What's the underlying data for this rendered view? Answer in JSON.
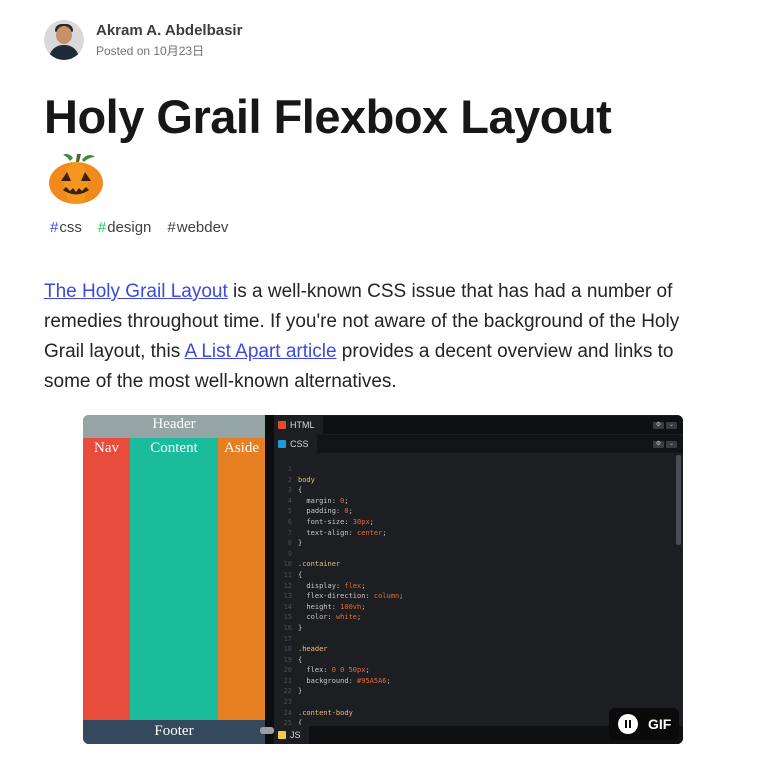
{
  "author": {
    "name": "Akram A. Abdelbasir",
    "posted": "Posted on 10月23日",
    "avatar_icon": "avatar"
  },
  "article": {
    "title": "Holy Grail Flexbox Layout",
    "title_emoji_icon": "jack-o-lantern-icon",
    "tags": [
      {
        "hash": "#",
        "name": "css",
        "hash_color": "#3b49df"
      },
      {
        "hash": "#",
        "name": "design",
        "hash_color": "#22c55e"
      },
      {
        "hash": "#",
        "name": "webdev",
        "hash_color": "#404040"
      }
    ],
    "paragraph": {
      "link1": "The Holy Grail Layout",
      "text1": " is a well-known CSS issue that has had a number of remedies throughout time. If you're not aware of the background of the Holy Grail layout, this ",
      "link2": "A List Apart article",
      "text2": " provides a decent overview and links to some of the most well-known alternatives."
    }
  },
  "gif": {
    "preview": {
      "header": "Header",
      "nav": "Nav",
      "content": "Content",
      "aside": "Aside",
      "footer": "Footer"
    },
    "tabs": {
      "html": "HTML",
      "css": "CSS",
      "js": "JS"
    },
    "code_lines": [
      [
        "1",
        ""
      ],
      [
        "2",
        "body"
      ],
      [
        "3",
        "{"
      ],
      [
        "4",
        "  margin: 0;"
      ],
      [
        "5",
        "  padding: 0;"
      ],
      [
        "6",
        "  font-size: 30px;"
      ],
      [
        "7",
        "  text-align: center;"
      ],
      [
        "8",
        "}"
      ],
      [
        "9",
        ""
      ],
      [
        "10",
        ".container"
      ],
      [
        "11",
        "{"
      ],
      [
        "12",
        "  display: flex;"
      ],
      [
        "13",
        "  flex-direction: column;"
      ],
      [
        "14",
        "  height: 100vh;"
      ],
      [
        "15",
        "  color: white;"
      ],
      [
        "16",
        "}"
      ],
      [
        "17",
        ""
      ],
      [
        "18",
        ".header"
      ],
      [
        "19",
        "{"
      ],
      [
        "20",
        "  flex: 0 0 50px;"
      ],
      [
        "21",
        "  background: #95A5A6;"
      ],
      [
        "22",
        "}"
      ],
      [
        "23",
        ""
      ],
      [
        "24",
        ".content-body"
      ],
      [
        "25",
        "{"
      ]
    ],
    "gif_label": "GIF",
    "colors": {
      "header": "#95a5a6",
      "nav": "#e74c3c",
      "content": "#1abc9c",
      "aside": "#e67e22",
      "footer": "#34495e"
    }
  }
}
